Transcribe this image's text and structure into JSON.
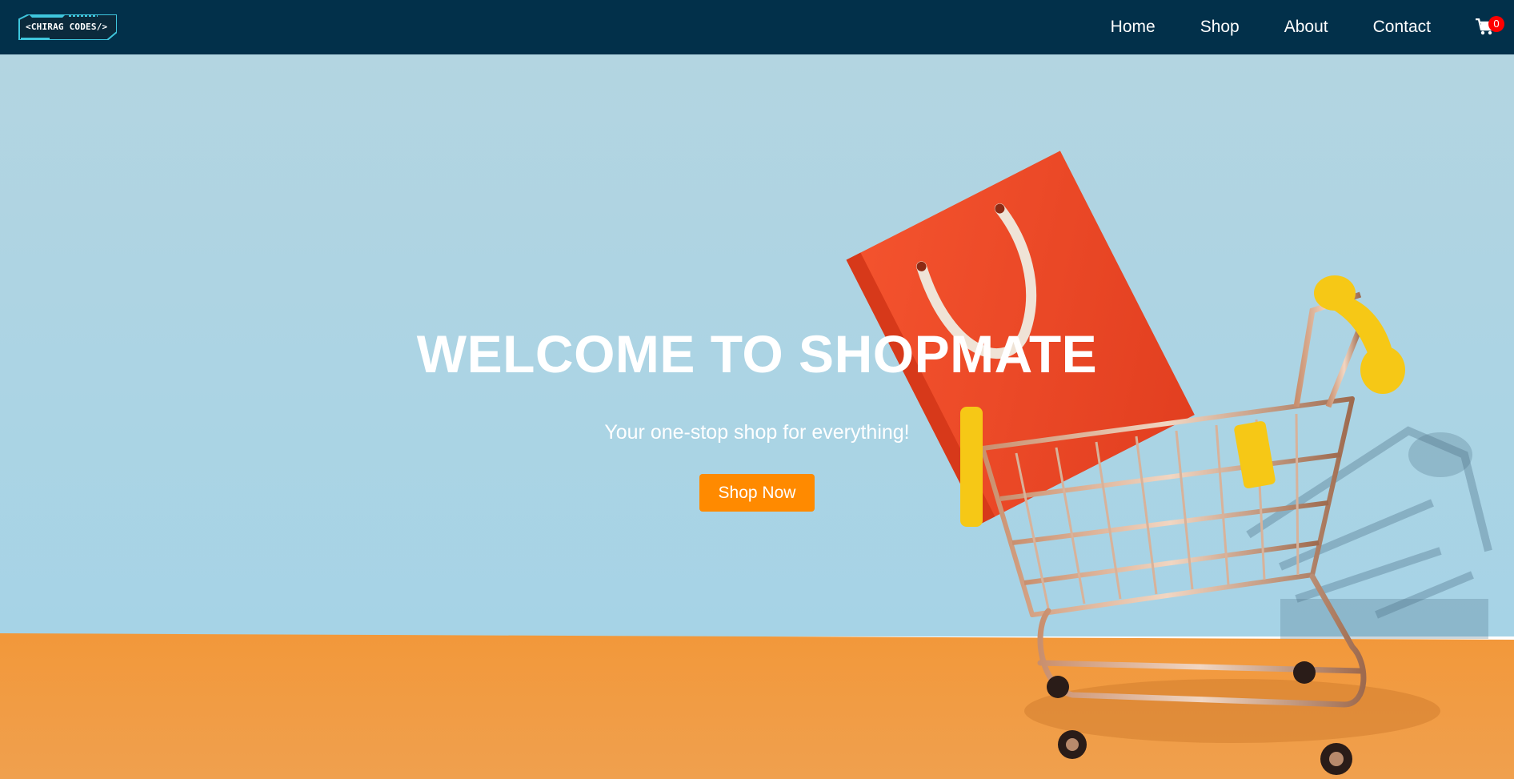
{
  "brand": {
    "logo_text": "<CHIRAG CODES/>"
  },
  "nav": {
    "links": [
      {
        "label": "Home"
      },
      {
        "label": "Shop"
      },
      {
        "label": "About"
      },
      {
        "label": "Contact"
      }
    ],
    "cart_count": "0",
    "cart_icon": "shopping-cart-icon"
  },
  "hero": {
    "title": "WELCOME TO SHOPMATE",
    "subtitle": "Your one-stop shop for everything!",
    "cta_label": "Shop Now",
    "image": "shopping-cart-with-red-bag"
  },
  "colors": {
    "navbar": "#02304a",
    "cta": "#ff8a00",
    "badge": "#ff0000",
    "sky": "#a9d1e2",
    "floor": "#f0983e",
    "bag": "#ee4a28",
    "handles": "#f6c816"
  }
}
